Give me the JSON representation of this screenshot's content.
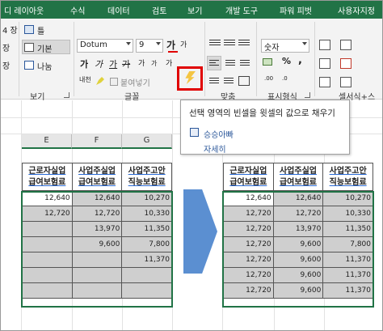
{
  "menu": {
    "items": [
      "디 레이아웃",
      "수식",
      "데이터",
      "검토",
      "보기",
      "개발 도구",
      "파워 피벗",
      "사용자지정"
    ]
  },
  "ribbon": {
    "left_fragments": [
      "4 장",
      "장",
      "장"
    ],
    "view_buttons": [
      "틀",
      "기본",
      "나눔"
    ],
    "view_group": "보기",
    "font_name": "Dotum",
    "font_size": "9",
    "bold_ga": "가",
    "small_ga": "가",
    "hanja_label": "내천",
    "paste_label": "붙여넣기",
    "font_group": "글꼴",
    "align_group": "맞춤",
    "number_format": "숫자",
    "percent": "%",
    "comma": ",",
    "number_group": "표시형식",
    "style_group": "셀서식+스"
  },
  "tooltip": {
    "title": "선택 영역의 빈셀을 윗셀의 값으로 채우기",
    "item": "승승아빠",
    "more": "자세히"
  },
  "sheet": {
    "col_headers": [
      "E",
      "F",
      "G"
    ],
    "table_headers": [
      [
        "근로자실업",
        "급여보험료"
      ],
      [
        "사업주실업",
        "급여보험료"
      ],
      [
        "사업주고안",
        "직능보험료"
      ]
    ],
    "left_rows": [
      [
        "12,640",
        "12,640",
        "10,270"
      ],
      [
        "12,720",
        "12,720",
        "10,330"
      ],
      [
        "",
        "13,970",
        "11,350"
      ],
      [
        "",
        "9,600",
        "7,800"
      ],
      [
        "",
        "",
        "11,370"
      ],
      [
        "",
        "",
        ""
      ],
      [
        "",
        "",
        ""
      ]
    ],
    "right_rows": [
      [
        "12,640",
        "12,640",
        "10,270"
      ],
      [
        "12,720",
        "12,720",
        "10,330"
      ],
      [
        "12,720",
        "13,970",
        "11,350"
      ],
      [
        "12,720",
        "9,600",
        "7,800"
      ],
      [
        "12,720",
        "9,600",
        "11,370"
      ],
      [
        "12,720",
        "9,600",
        "11,370"
      ],
      [
        "12,720",
        "9,600",
        "11,370"
      ]
    ]
  },
  "colors": {
    "accent": "#217346",
    "highlight": "#e00000",
    "arrow": "#5b8fd1",
    "filled_cell": "#cfcfcf"
  }
}
